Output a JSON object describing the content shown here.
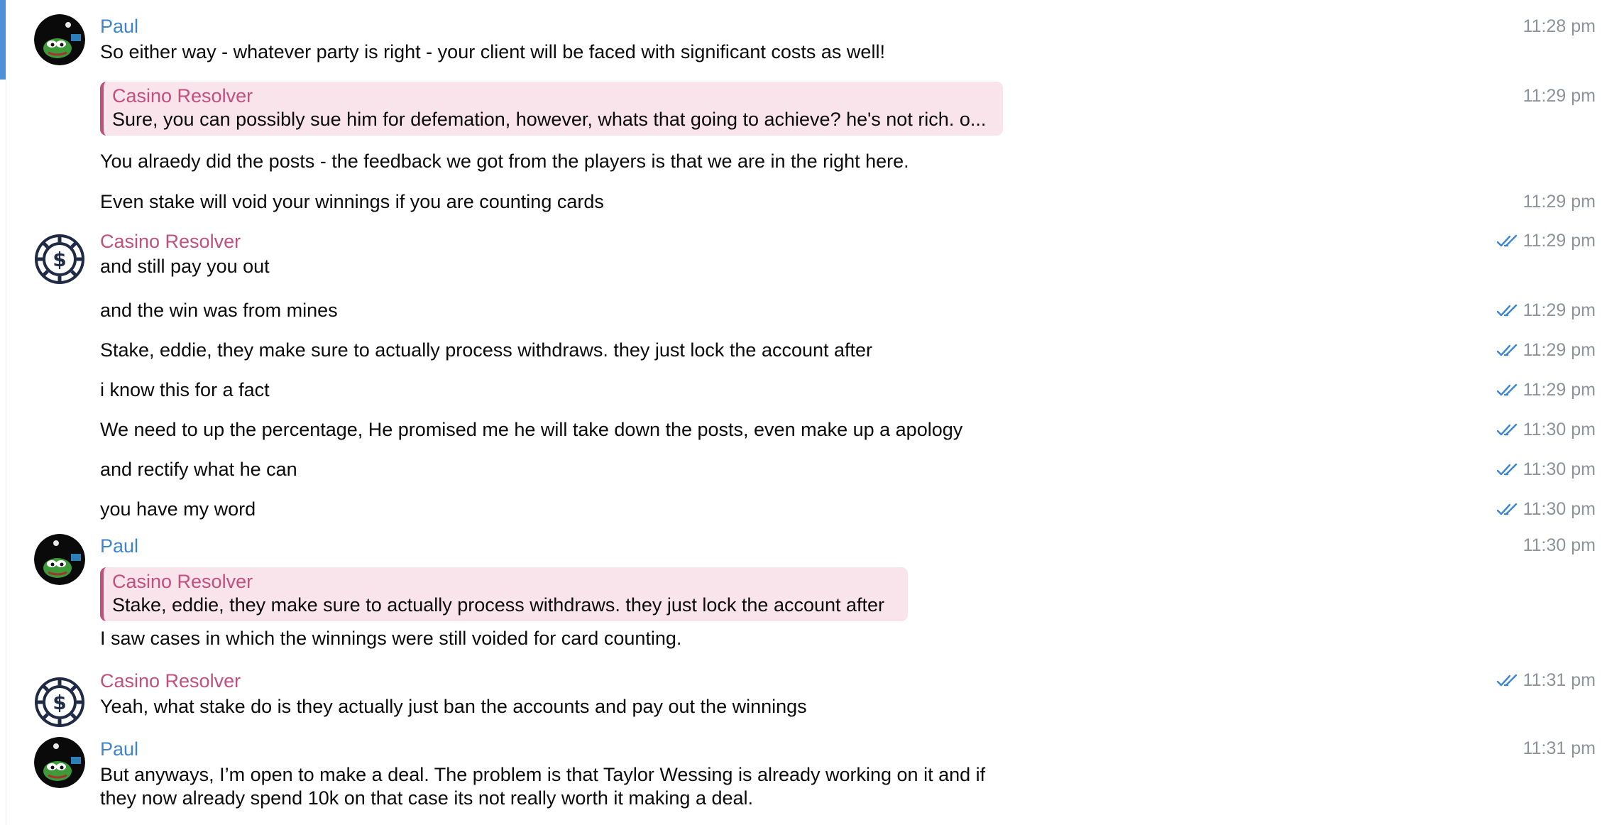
{
  "senders": {
    "paul": "Paul",
    "casino": "Casino Resolver"
  },
  "colors": {
    "paul_name": "#3d86cf",
    "casino_name": "#c0507c",
    "reply_bg": "#f9e4ec",
    "timestamp": "#8e9399",
    "read_check": "#3d86cf"
  },
  "icons": {
    "paul_avatar": "pepe-frog-avatar",
    "casino_avatar": "casino-chip-dollar-icon",
    "read_receipt": "double-check-icon"
  },
  "messages": [
    {
      "sender": "Paul",
      "text": "So either way - whatever party is right - your client will be faced with significant costs as well!",
      "time": "11:28 pm"
    },
    {
      "reply_to": {
        "sender": "Casino Resolver",
        "text": "Sure, you can possibly sue him for defemation, however, whats that going to achieve? he's not rich. o..."
      },
      "time": "11:29 pm"
    },
    {
      "text": "You alraedy did the posts - the feedback we got from the players is that we are in the right here."
    },
    {
      "text": "Even stake will void your winnings if you are counting cards",
      "time": "11:29 pm"
    },
    {
      "sender": "Casino Resolver",
      "text": "and still pay you out",
      "time": "11:29 pm",
      "read": true
    },
    {
      "text": "and the win was from mines",
      "time": "11:29 pm",
      "read": true
    },
    {
      "text": "Stake, eddie, they make sure to actually process withdraws. they just lock the account after",
      "time": "11:29 pm",
      "read": true
    },
    {
      "text": "i know this for a fact",
      "time": "11:29 pm",
      "read": true
    },
    {
      "text": "We need to up the percentage, He promised me he will take down the posts, even make up a apology",
      "time": "11:30 pm",
      "read": true
    },
    {
      "text": "and rectify what he can",
      "time": "11:30 pm",
      "read": true
    },
    {
      "text": "you have my word",
      "time": "11:30 pm",
      "read": true
    },
    {
      "sender": "Paul",
      "reply_to": {
        "sender": "Casino Resolver",
        "text": "Stake, eddie, they make sure to actually process withdraws. they just lock the account after"
      },
      "text": "I saw cases in which the winnings were still voided for card counting.",
      "time": "11:30 pm"
    },
    {
      "sender": "Casino Resolver",
      "text": "Yeah, what stake do is they actually just ban the accounts and pay out the winnings",
      "time": "11:31 pm",
      "read": true
    },
    {
      "sender": "Paul",
      "text": "But anyways, I’m open to make a deal. The problem is that Taylor Wessing is already working on it and if they now already spend 10k on that case its not really worth it making a deal.",
      "time": "11:31 pm"
    }
  ]
}
